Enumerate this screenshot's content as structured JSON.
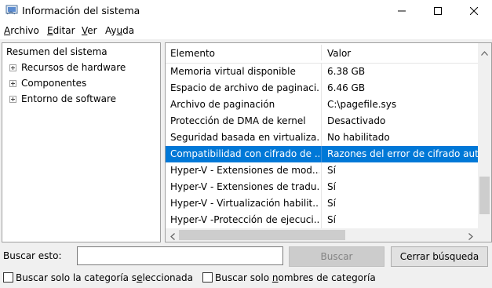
{
  "window": {
    "title": "Información del sistema",
    "icon": "system-info-icon"
  },
  "menu": [
    {
      "pre": "",
      "key": "A",
      "post": "rchivo"
    },
    {
      "pre": "",
      "key": "E",
      "post": "ditar"
    },
    {
      "pre": "",
      "key": "V",
      "post": "er"
    },
    {
      "pre": "Ay",
      "key": "u",
      "post": "da"
    }
  ],
  "tree": {
    "root": "Resumen del sistema",
    "children": [
      "Recursos de hardware",
      "Componentes",
      "Entorno de software"
    ]
  },
  "list": {
    "columns": {
      "item": "Elemento",
      "value": "Valor"
    },
    "rows": [
      {
        "item": "Memoria virtual disponible",
        "value": "6.38 GB"
      },
      {
        "item": "Espacio de archivo de paginaci...",
        "value": "6.46 GB"
      },
      {
        "item": "Archivo de paginación",
        "value": "C:\\pagefile.sys"
      },
      {
        "item": "Protección de DMA de kernel",
        "value": "Desactivado"
      },
      {
        "item": "Seguridad basada en virtualiza...",
        "value": "No habilitado"
      },
      {
        "item": "Compatibilidad con cifrado de ...",
        "value": "Razones del error de cifrado aut"
      },
      {
        "item": "Hyper-V - Extensiones de mod...",
        "value": "Sí"
      },
      {
        "item": "Hyper-V - Extensiones de tradu...",
        "value": "Sí"
      },
      {
        "item": "Hyper-V - Virtualización habilit...",
        "value": "Sí"
      },
      {
        "item": "Hyper-V -Protección de ejecuci...",
        "value": "Sí"
      }
    ],
    "selected_index": 5
  },
  "search": {
    "label": "Buscar esto:",
    "value": "",
    "button": "Buscar",
    "close_button": "Cerrar búsqueda"
  },
  "options": {
    "selected_category_pre": "Buscar solo la categoría s",
    "selected_category_key": "e",
    "selected_category_post": "leccionada",
    "category_names_pre": "Buscar solo ",
    "category_names_key": "n",
    "category_names_post": "ombres de categoría"
  },
  "colors": {
    "selection": "#0078d7",
    "scroll_thumb": "#cdcdcd"
  }
}
